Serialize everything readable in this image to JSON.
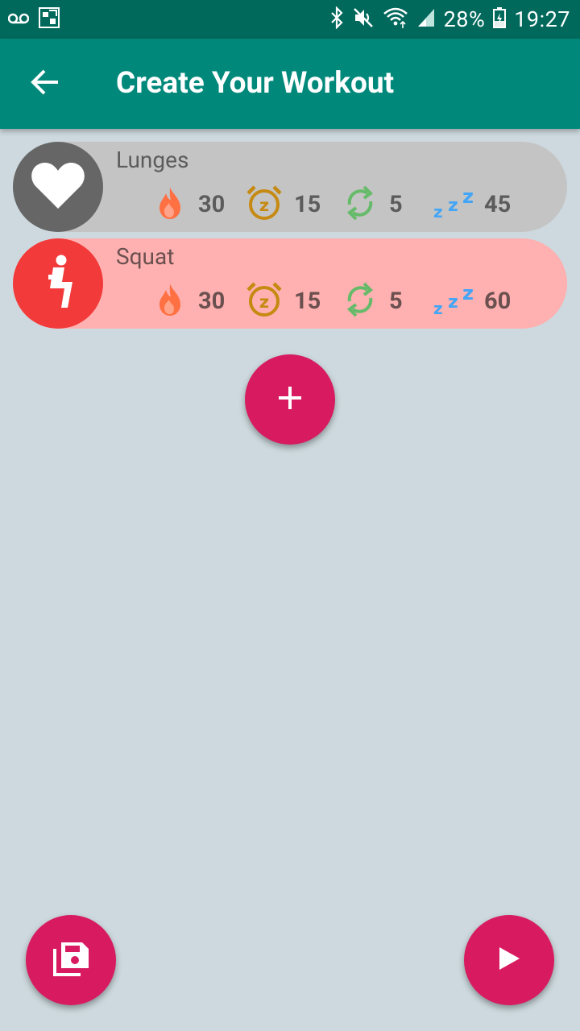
{
  "status_bar": {
    "battery": "28%",
    "time": "19:27"
  },
  "app_bar": {
    "title": "Create Your Workout"
  },
  "exercises": [
    {
      "name": "Lunges",
      "calories": "30",
      "duration": "15",
      "reps": "5",
      "rest": "45",
      "icon": "heart-icon",
      "card_color": "#c4c4c4",
      "avatar_color": "#666666",
      "text_color": "#5c5c5c"
    },
    {
      "name": "Squat",
      "calories": "30",
      "duration": "15",
      "reps": "5",
      "rest": "60",
      "icon": "squat-icon",
      "card_color": "#ffb0b0",
      "avatar_color": "#f23a3a",
      "text_color": "#6b5050"
    }
  ],
  "colors": {
    "primary": "#00897b",
    "primary_dark": "#00695c",
    "accent": "#d81b60",
    "background": "#cdd9de",
    "flame": "#ff7043",
    "timer": "#c68a12",
    "repeat": "#66bb6a",
    "rest": "#42a5f5"
  },
  "actions": {
    "add": "add-icon",
    "save": "save-icon",
    "play": "play-icon"
  }
}
